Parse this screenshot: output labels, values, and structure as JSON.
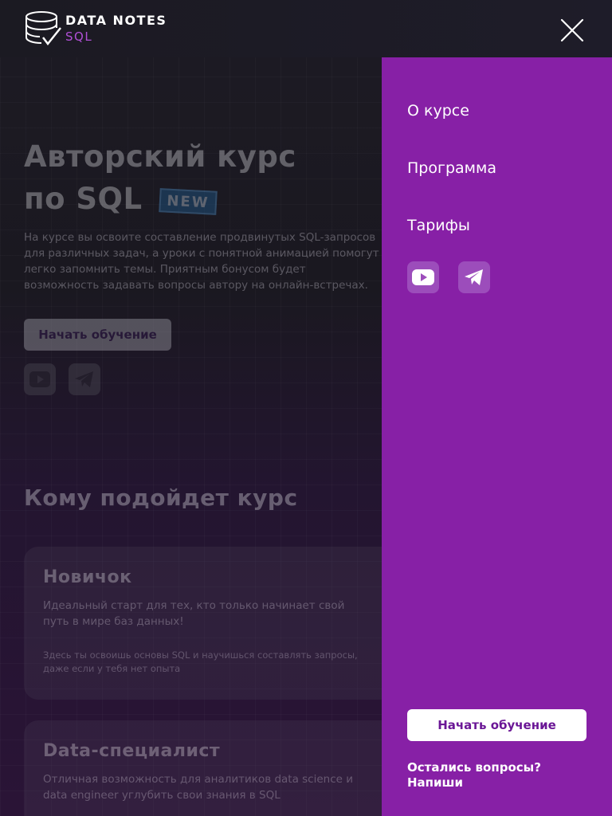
{
  "logo": {
    "top_text": "DATA NOTES",
    "bottom_text": "SQL"
  },
  "hero": {
    "title_line1": "Авторский курс",
    "title_line2": "по SQL",
    "badge": "NEW",
    "description": "На курсе вы освоите составление продвинутых SQL-запросов для различных задач, а уроки с понятной анимацией помогут легко запомнить темы. Приятным бонусом будет возможность задавать вопросы автору на онлайн-встречах.",
    "cta_label": "Начать обучение"
  },
  "audience": {
    "section_title": "Кому подойдет курс",
    "cards": [
      {
        "title": "Новичок",
        "text": "Идеальный старт для тех, кто только начинает свой путь в мире баз данных!",
        "note": "Здесь ты освоишь основы SQL и научишься составлять запросы, даже если у тебя нет опыта"
      },
      {
        "title": "Data-специалист",
        "text": "Отличная возможность для аналитиков data science и data engineer углубить свои знания в SQL",
        "note": ""
      }
    ]
  },
  "menu": {
    "items": [
      {
        "label": "О курсе"
      },
      {
        "label": "Программа"
      },
      {
        "label": "Тарифы"
      }
    ],
    "social": [
      {
        "icon": "youtube-icon"
      },
      {
        "icon": "telegram-icon"
      }
    ],
    "cta_label": "Начать обучение",
    "contact_line1": "Остались вопросы?",
    "contact_line2": "Напиши"
  },
  "colors": {
    "menu_bg": "#8720a6",
    "accent": "#b04fd6",
    "badge": "#1f6aa8"
  }
}
